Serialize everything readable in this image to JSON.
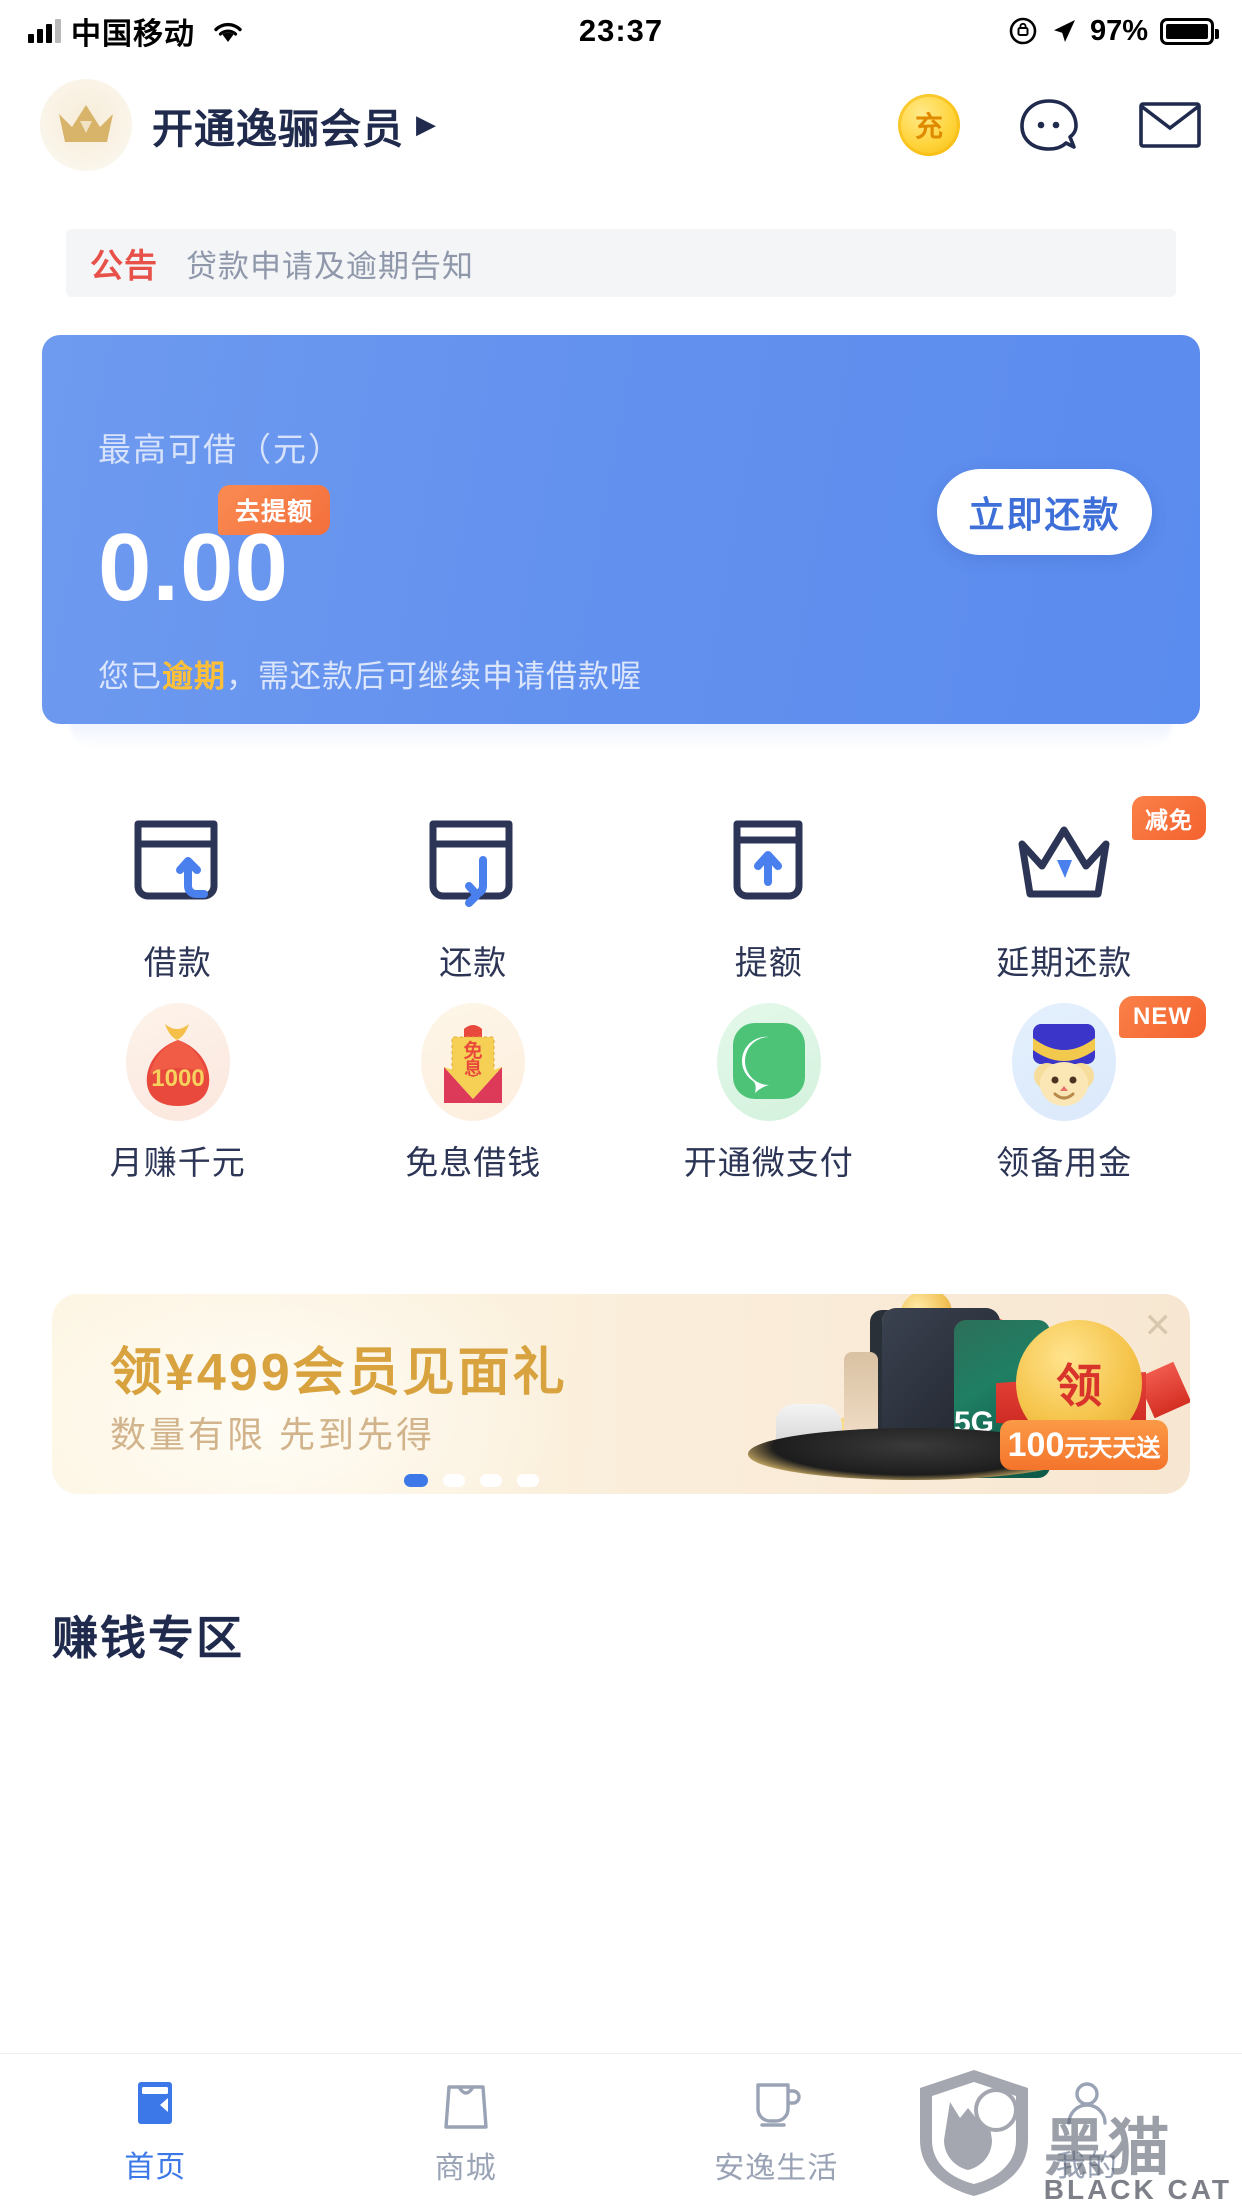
{
  "status_bar": {
    "carrier": "中国移动",
    "time": "23:37",
    "battery_percent": "97%",
    "icons": [
      "signal-icon",
      "wifi-icon",
      "rotation-lock-icon",
      "location-arrow-icon",
      "battery-icon"
    ]
  },
  "header": {
    "vip_title": "开通逸骊会员",
    "vip_arrow": "▶",
    "crown_icon": "crown-icon",
    "recharge_label": "充",
    "icons": [
      "recharge-coin-icon",
      "customer-service-icon",
      "mail-icon"
    ]
  },
  "announcement": {
    "tag": "公告",
    "text": "贷款申请及逾期告知"
  },
  "credit_card": {
    "label": "最高可借（元）",
    "badge": "去提额",
    "amount": "0.00",
    "button": "立即还款",
    "note_prefix": "您已",
    "note_highlight": "逾期",
    "note_suffix": "，需还款后可继续申请借款喔",
    "gradient_from": "#6e9aef",
    "gradient_to": "#5a8bee",
    "highlight_color": "#ffc038",
    "badge_color": "#f36f3c"
  },
  "quick_actions": {
    "row1": [
      {
        "label": "借款",
        "icon": "card-arrow-in-icon",
        "badge": ""
      },
      {
        "label": "还款",
        "icon": "card-arrow-out-icon",
        "badge": ""
      },
      {
        "label": "提额",
        "icon": "card-arrow-up-icon",
        "badge": ""
      },
      {
        "label": "延期还款",
        "icon": "crown-icon",
        "badge": "减免"
      }
    ],
    "row2": [
      {
        "label": "月赚千元",
        "icon": "money-bag-icon",
        "badge": "",
        "art_text": "1000"
      },
      {
        "label": "免息借钱",
        "icon": "red-envelope-icon",
        "badge": "",
        "art_text": "免息"
      },
      {
        "label": "开通微支付",
        "icon": "green-check-icon",
        "badge": "",
        "art_text": ""
      },
      {
        "label": "领备用金",
        "icon": "mouse-mascot-icon",
        "badge": "NEW",
        "art_text": ""
      }
    ]
  },
  "banner": {
    "title": "领¥499会员见面礼",
    "subtitle": "数量有限 先到先得",
    "coin_label": "领",
    "tag_amount": "100",
    "tag_suffix": "元天天送",
    "phone_badge": "5G",
    "close_icon": "close-icon",
    "dots_total": 4,
    "dots_active_index": 0,
    "active_dot_color": "#3d78e8"
  },
  "section": {
    "earn_title": "赚钱专区"
  },
  "tabbar": {
    "items": [
      {
        "label": "首页",
        "icon": "home-icon",
        "active": true
      },
      {
        "label": "商城",
        "icon": "shop-bag-icon",
        "active": false
      },
      {
        "label": "安逸生活",
        "icon": "cup-icon",
        "active": false
      },
      {
        "label": "我的",
        "icon": "user-icon",
        "active": false
      }
    ],
    "active_color": "#3d78e8",
    "inactive_color": "#9aa3b5"
  },
  "watermark": {
    "cn": "黑猫",
    "en": "BLACK CAT"
  }
}
